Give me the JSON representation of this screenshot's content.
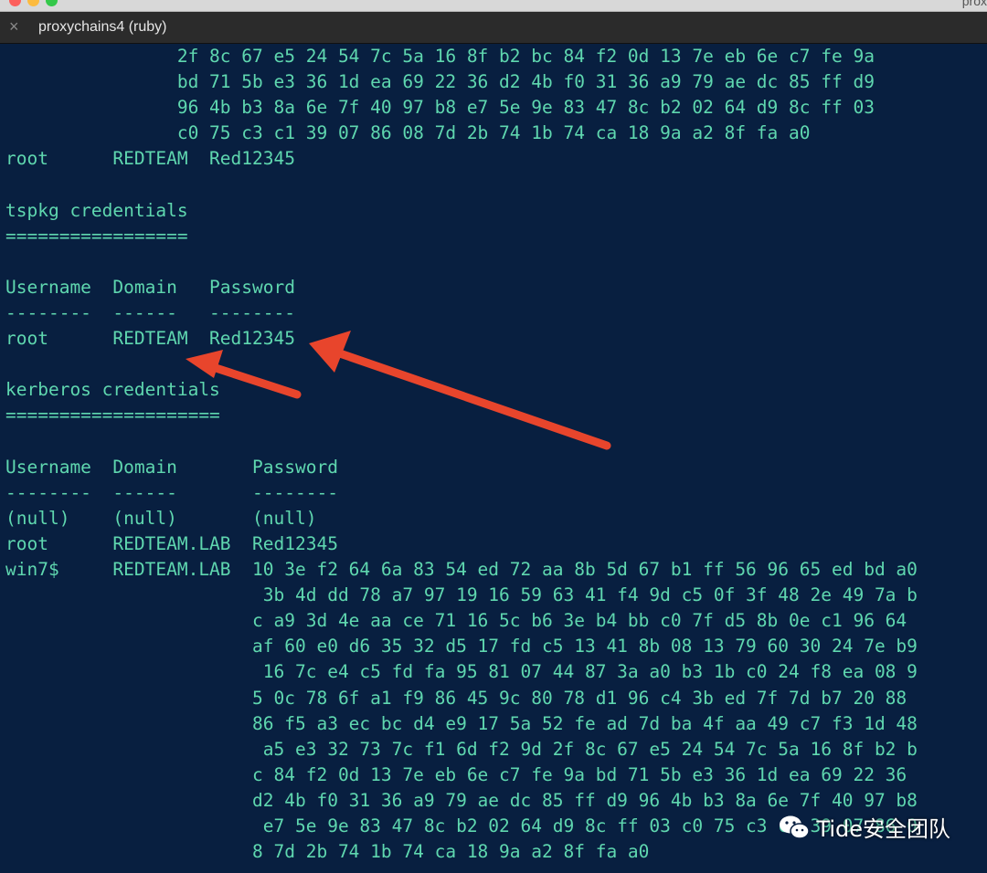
{
  "window": {
    "title_fragment": "prox"
  },
  "tab": {
    "label": "proxychains4 (ruby)",
    "close_icon": "×"
  },
  "terminal": {
    "lines": [
      "                2f 8c 67 e5 24 54 7c 5a 16 8f b2 bc 84 f2 0d 13 7e eb 6e c7 fe 9a",
      "                bd 71 5b e3 36 1d ea 69 22 36 d2 4b f0 31 36 a9 79 ae dc 85 ff d9",
      "                96 4b b3 8a 6e 7f 40 97 b8 e7 5e 9e 83 47 8c b2 02 64 d9 8c ff 03",
      "                c0 75 c3 c1 39 07 86 08 7d 2b 74 1b 74 ca 18 9a a2 8f fa a0",
      "root      REDTEAM  Red12345",
      "",
      "tspkg credentials",
      "=================",
      "",
      "Username  Domain   Password",
      "--------  ------   --------",
      "root      REDTEAM  Red12345",
      "",
      "kerberos credentials",
      "====================",
      "",
      "Username  Domain       Password",
      "--------  ------       --------",
      "(null)    (null)       (null)",
      "root      REDTEAM.LAB  Red12345",
      "win7$     REDTEAM.LAB  10 3e f2 64 6a 83 54 ed 72 aa 8b 5d 67 b1 ff 56 96 65 ed bd a0",
      "                        3b 4d dd 78 a7 97 19 16 59 63 41 f4 9d c5 0f 3f 48 2e 49 7a b",
      "                       c a9 3d 4e aa ce 71 16 5c b6 3e b4 bb c0 7f d5 8b 0e c1 96 64",
      "                       af 60 e0 d6 35 32 d5 17 fd c5 13 41 8b 08 13 79 60 30 24 7e b9",
      "                        16 7c e4 c5 fd fa 95 81 07 44 87 3a a0 b3 1b c0 24 f8 ea 08 9",
      "                       5 0c 78 6f a1 f9 86 45 9c 80 78 d1 96 c4 3b ed 7f 7d b7 20 88",
      "                       86 f5 a3 ec bc d4 e9 17 5a 52 fe ad 7d ba 4f aa 49 c7 f3 1d 48",
      "                        a5 e3 32 73 7c f1 6d f2 9d 2f 8c 67 e5 24 54 7c 5a 16 8f b2 b",
      "                       c 84 f2 0d 13 7e eb 6e c7 fe 9a bd 71 5b e3 36 1d ea 69 22 36",
      "                       d2 4b f0 31 36 a9 79 ae dc 85 ff d9 96 4b b3 8a 6e 7f 40 97 b8",
      "                        e7 5e 9e 83 47 8c b2 02 64 d9 8c ff 03 c0 75 c3 c1 39 07 86 0",
      "                       8 7d 2b 74 1b 74 ca 18 9a a2 8f fa a0"
    ],
    "text_color": "#5fd7af",
    "background_color": "#081f40"
  },
  "annotations": {
    "arrow_color": "#e8452c",
    "arrow_count": 2
  },
  "watermark": {
    "icon": "wechat-icon",
    "text": "Tide安全团队"
  }
}
